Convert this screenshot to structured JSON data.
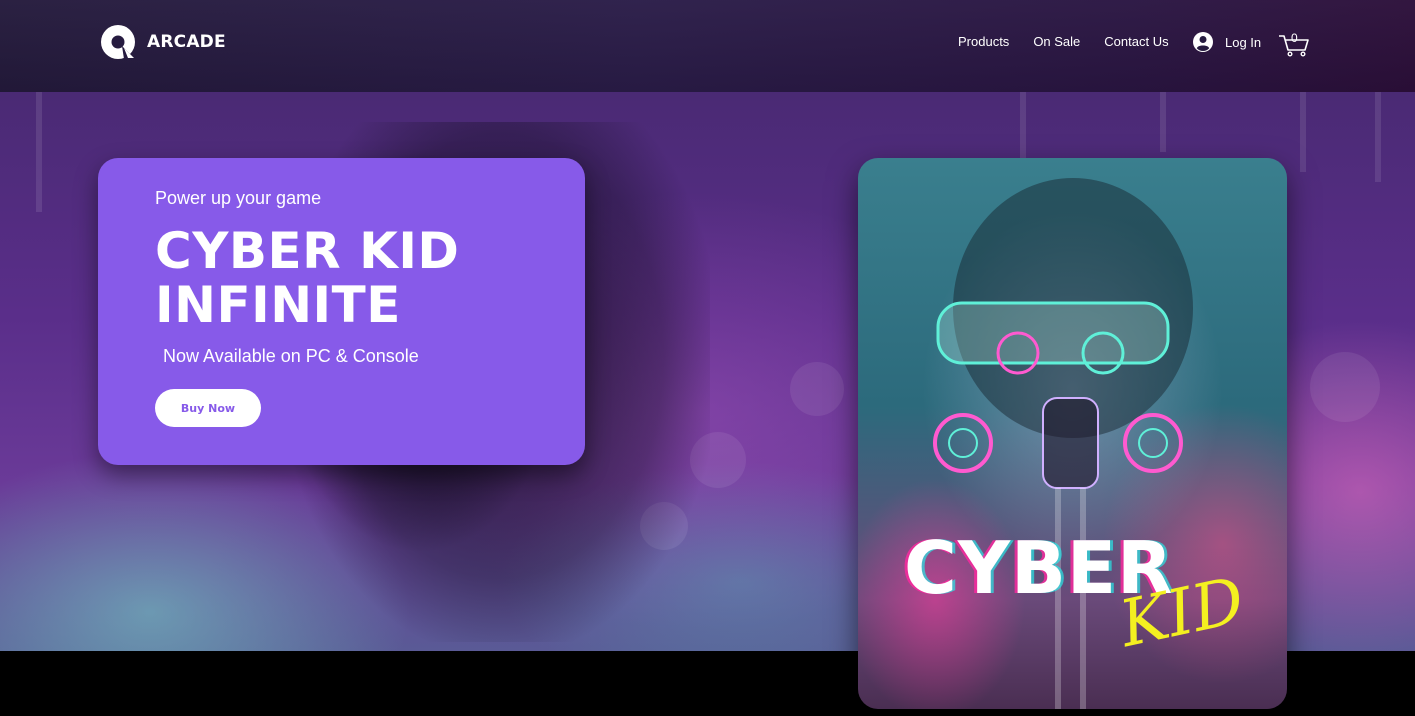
{
  "header": {
    "logo_text": "ARCADE",
    "nav": [
      {
        "label": "Products"
      },
      {
        "label": "On Sale"
      },
      {
        "label": "Contact Us"
      }
    ],
    "login_label": "Log In",
    "cart_count": "0"
  },
  "hero": {
    "tagline": "Power up your game",
    "title_line1": "CYBER KID",
    "title_line2": "INFINITE",
    "availability": "Now Available on PC & Console",
    "cta_label": "Buy Now",
    "cover_title": "CYBER",
    "cover_subtitle": "KID"
  },
  "colors": {
    "accent": "#875ae9",
    "header_bg": "#261b40",
    "cover_highlight": "#f4f020"
  },
  "icons": [
    "arcade-logo-icon",
    "user-icon",
    "cart-icon"
  ]
}
